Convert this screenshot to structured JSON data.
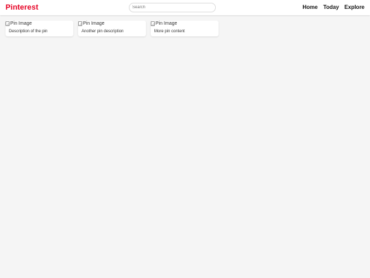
{
  "header": {
    "logo": "Pinterest",
    "search_placeholder": "Search",
    "nav": [
      "Home",
      "Today",
      "Explore"
    ]
  },
  "pins": [
    {
      "image_alt": "Pin Image",
      "description": "Description of the pin"
    },
    {
      "image_alt": "Pin Image",
      "description": "Another pin description"
    },
    {
      "image_alt": "Pin Image",
      "description": "More pin content"
    }
  ],
  "colors": {
    "brand": "#e60023",
    "background": "#f5f5f5",
    "card": "#ffffff"
  }
}
